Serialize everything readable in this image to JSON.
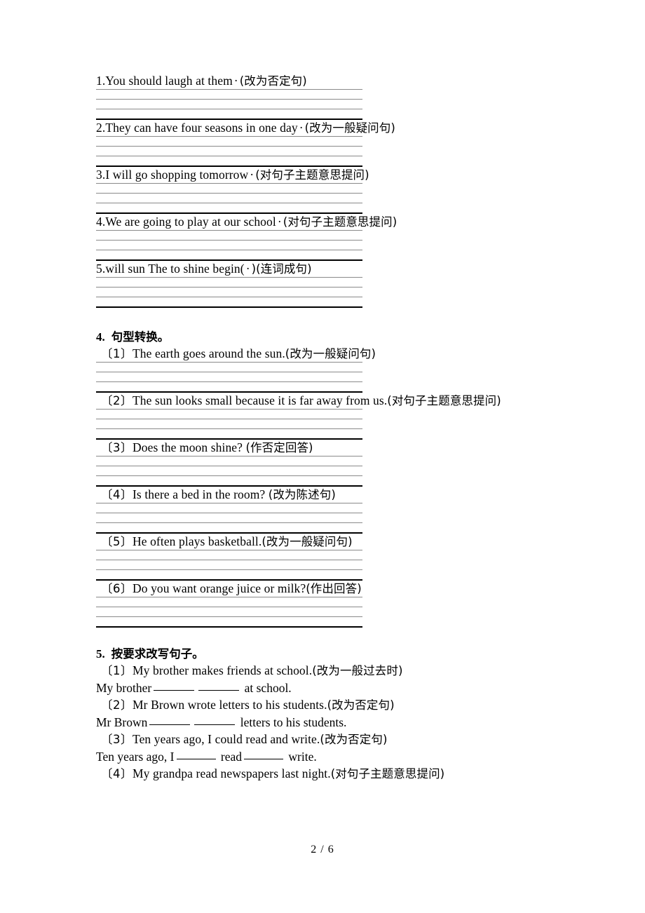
{
  "page": {
    "footer": "2 / 6"
  },
  "section_three_items": [
    {
      "id": "q1",
      "number": "1.",
      "english": "You should laugh at them",
      "separator": "·",
      "instruction": "(改为否定句)"
    },
    {
      "id": "q2",
      "number": "2.",
      "english": "They can have four seasons in one day",
      "separator": "·",
      "instruction": "(改为一般疑问句)"
    },
    {
      "id": "q3",
      "number": "3.",
      "english": "I will go shopping tomorrow",
      "separator": "·",
      "instruction": "(对句子主题意思提问)"
    },
    {
      "id": "q4",
      "number": "4.",
      "english": "We are going to play at our school",
      "separator": "·",
      "instruction": "(对句子主题意思提问)"
    },
    {
      "id": "q5",
      "number": "5.",
      "english": "will sun The to shine begin(",
      "separator": "·",
      "instruction": ")(连词成句)"
    }
  ],
  "section_four": {
    "number": "4.",
    "title": "句型转换。",
    "items": [
      {
        "bracket": "〔1〕",
        "english": "The earth goes around the sun.",
        "instruction": "(改为一般疑问句)"
      },
      {
        "bracket": "〔2〕",
        "english": "The sun looks small because it is far away from us.",
        "instruction": "(对句子主题意思提问)"
      },
      {
        "bracket": "〔3〕",
        "english": "Does the moon shine? ",
        "instruction": "(作否定回答)"
      },
      {
        "bracket": "〔4〕",
        "english": "Is there a bed in the room? ",
        "instruction": "(改为陈述句)"
      },
      {
        "bracket": "〔5〕",
        "english": "He often plays basketball.",
        "instruction": "(改为一般疑问句)"
      },
      {
        "bracket": "〔6〕",
        "english": "Do you want orange juice or milk?",
        "instruction": "(作出回答)"
      }
    ]
  },
  "section_five": {
    "number": "5.",
    "title": "按要求改写句子。",
    "items": [
      {
        "bracket": "〔1〕",
        "english": "My brother makes friends at school.",
        "instruction": "(改为一般过去时)",
        "answer_prefix": "My brother",
        "answer_middle": "",
        "answer_suffix": "at school.",
        "blanks": 2
      },
      {
        "bracket": "〔2〕",
        "english": "Mr Brown wrote letters to his students.",
        "instruction": "(改为否定句)",
        "answer_prefix": "Mr Brown",
        "answer_middle": "",
        "answer_suffix": "letters to his students.",
        "blanks": 2
      },
      {
        "bracket": "〔3〕",
        "english": "Ten years ago, I could read and write.",
        "instruction": "(改为否定句)",
        "answer_prefix": "Ten years ago, I",
        "answer_middle": "read",
        "answer_suffix": "write.",
        "blanks": 2
      },
      {
        "bracket": "〔4〕",
        "english": "My grandpa read newspapers last night.",
        "instruction": "(对句子主题意思提问)",
        "answer_prefix": "",
        "answer_middle": "",
        "answer_suffix": "",
        "blanks": 0
      }
    ]
  }
}
